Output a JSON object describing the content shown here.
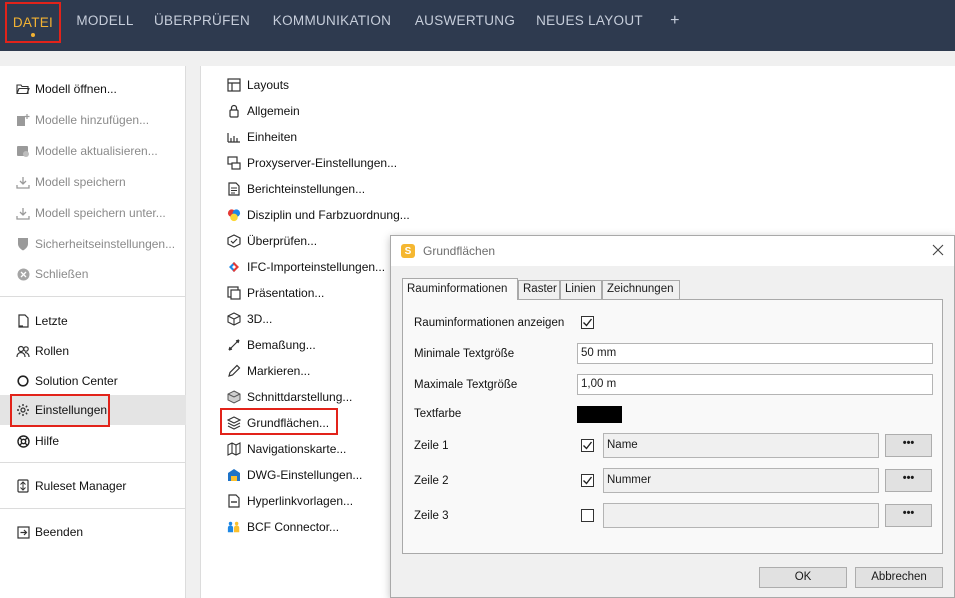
{
  "topbar": {
    "tabs": [
      {
        "label": "DATEI"
      },
      {
        "label": "MODELL"
      },
      {
        "label": "ÜBERPRÜFEN"
      },
      {
        "label": "KOMMUNIKATION"
      },
      {
        "label": "AUSWERTUNG"
      },
      {
        "label": "NEUES LAYOUT"
      },
      {
        "label": "+"
      }
    ]
  },
  "leftnav": {
    "items": [
      {
        "label": "Modell öffnen...",
        "icon": "folder-open-icon"
      },
      {
        "label": "Modelle hinzufügen...",
        "icon": "add-model-icon"
      },
      {
        "label": "Modelle aktualisieren...",
        "icon": "refresh-model-icon"
      },
      {
        "label": "Modell speichern",
        "icon": "save-icon"
      },
      {
        "label": "Modell speichern unter...",
        "icon": "save-as-icon"
      },
      {
        "label": "Sicherheitseinstellungen...",
        "icon": "shield-icon"
      },
      {
        "label": "Schließen",
        "icon": "close-circle-icon"
      },
      {
        "label": "Letzte",
        "icon": "recent-icon"
      },
      {
        "label": "Rollen",
        "icon": "roles-icon"
      },
      {
        "label": "Solution Center",
        "icon": "circle-icon"
      },
      {
        "label": "Einstellungen",
        "icon": "gear-icon"
      },
      {
        "label": "Hilfe",
        "icon": "help-icon"
      },
      {
        "label": "Ruleset Manager",
        "icon": "ruleset-icon"
      },
      {
        "label": "Beenden",
        "icon": "exit-icon"
      }
    ]
  },
  "settings": {
    "items": [
      {
        "label": "Layouts",
        "icon": "layout-icon"
      },
      {
        "label": "Allgemein",
        "icon": "lock-icon"
      },
      {
        "label": "Einheiten",
        "icon": "ruler-icon"
      },
      {
        "label": "Proxyserver-Einstellungen...",
        "icon": "proxy-icon"
      },
      {
        "label": "Berichteinstellungen...",
        "icon": "report-icon"
      },
      {
        "label": "Disziplin und Farbzuordnung...",
        "icon": "color-discipline-icon"
      },
      {
        "label": "Überprüfen...",
        "icon": "check-icon"
      },
      {
        "label": "IFC-Importeinstellungen...",
        "icon": "ifc-icon"
      },
      {
        "label": "Präsentation...",
        "icon": "presentation-icon"
      },
      {
        "label": "3D...",
        "icon": "cube-icon"
      },
      {
        "label": "Bemaßung...",
        "icon": "dimension-icon"
      },
      {
        "label": "Markieren...",
        "icon": "pencil-icon"
      },
      {
        "label": "Schnittdarstellung...",
        "icon": "section-icon"
      },
      {
        "label": "Grundflächen...",
        "icon": "layers-icon"
      },
      {
        "label": "Navigationskarte...",
        "icon": "map-icon"
      },
      {
        "label": "DWG-Einstellungen...",
        "icon": "dwg-icon"
      },
      {
        "label": "Hyperlinkvorlagen...",
        "icon": "hyperlink-icon"
      },
      {
        "label": "BCF Connector...",
        "icon": "bcf-icon"
      }
    ]
  },
  "dialog": {
    "app_icon_letter": "S",
    "title": "Grundflächen",
    "tabs": [
      {
        "label": "Rauminformationen"
      },
      {
        "label": "Raster"
      },
      {
        "label": "Linien"
      },
      {
        "label": "Zeichnungen"
      }
    ],
    "show_info_label": "Rauminformationen anzeigen",
    "min_label": "Minimale Textgröße",
    "min_value": "50 mm",
    "max_label": "Maximale Textgröße",
    "max_value": "1,00 m",
    "color_label": "Textfarbe",
    "text_color": "#000000",
    "rows": [
      {
        "label": "Zeile 1",
        "checked": true,
        "value": "Name"
      },
      {
        "label": "Zeile 2",
        "checked": true,
        "value": "Nummer"
      },
      {
        "label": "Zeile 3",
        "checked": false,
        "value": ""
      }
    ],
    "dots_label": "•••",
    "ok_label": "OK",
    "cancel_label": "Abbrechen"
  },
  "colors": {
    "topbar": "#2e3a4f",
    "active_tab": "#f2b233",
    "highlight": "#e2231a"
  }
}
